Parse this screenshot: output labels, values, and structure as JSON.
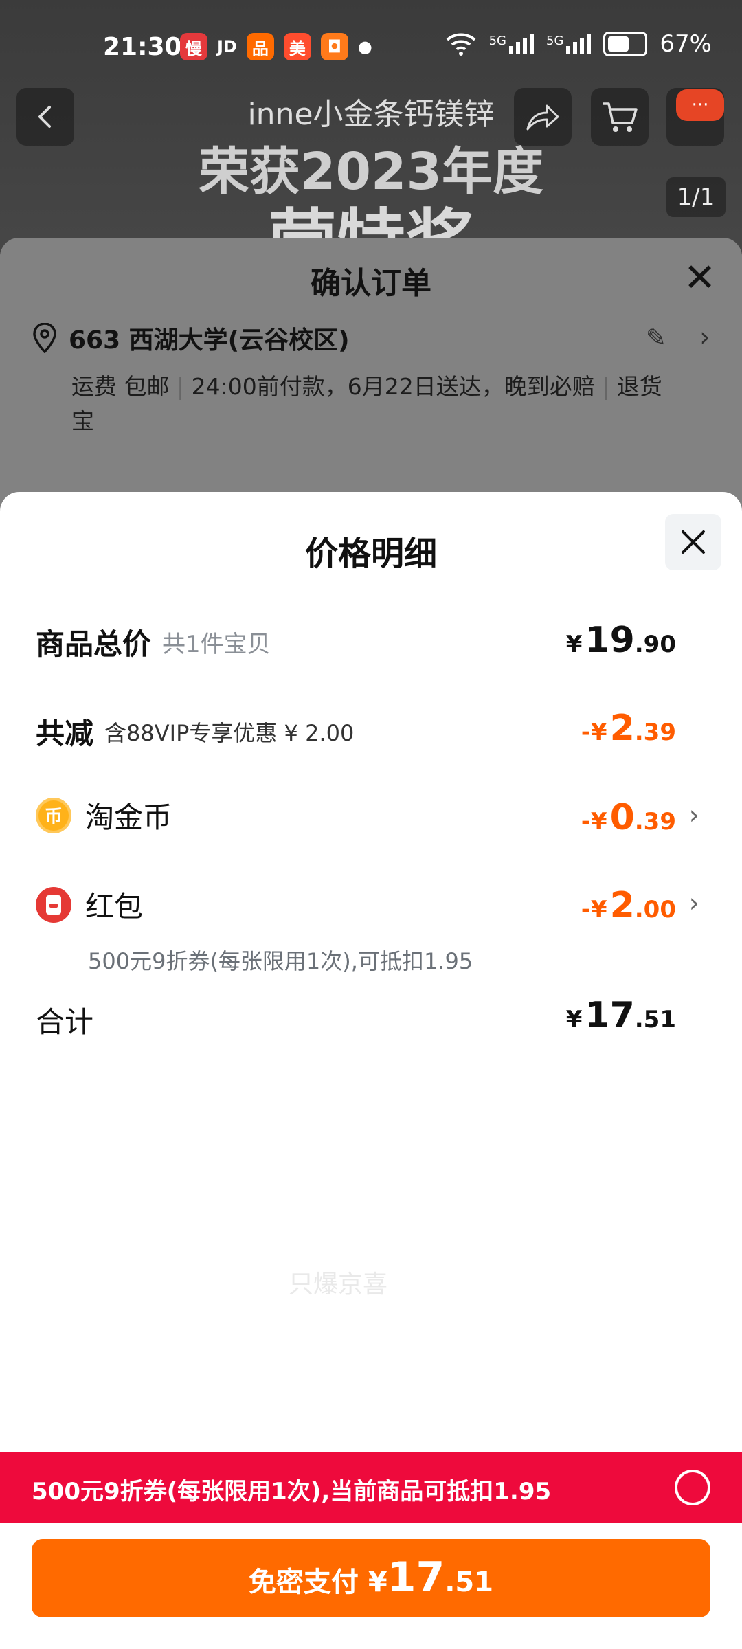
{
  "status_bar": {
    "time": "21:30",
    "battery": "67%",
    "signal1": "5G",
    "signal2": "5G",
    "jd": "JD"
  },
  "product_page": {
    "title": "inne小金条钙镁锌",
    "banner_line1": "荣获2023年度",
    "banner_line2": "营特奖",
    "image_counter": "1/1"
  },
  "confirm_order": {
    "title": "确认订单",
    "address": "663 西湖大学(云谷校区)",
    "shipping": "运费 包邮",
    "delivery": "24:00前付款，6月22日送达，晚到必赔",
    "return": "退货宝"
  },
  "price_detail": {
    "title": "价格明细",
    "goods_total": {
      "label": "商品总价",
      "sub": "共1件宝贝",
      "currency": "¥",
      "int": "19",
      "dec": ".90"
    },
    "total_discount": {
      "label": "共减",
      "sub": "含88VIP专享优惠 ¥ 2.00",
      "currency": "-¥",
      "int": "2",
      "dec": ".39"
    },
    "taojinbi": {
      "label": "淘金币",
      "currency": "-¥",
      "int": "0",
      "dec": ".39"
    },
    "hongbao": {
      "label": "红包",
      "currency": "-¥",
      "int": "2",
      "dec": ".00",
      "sub": "500元9折券(每张限用1次),可抵扣1.95"
    },
    "total": {
      "label": "合计",
      "currency": "¥",
      "int": "17",
      "dec": ".51"
    },
    "watermark": "只爆京喜"
  },
  "coupon_bar": {
    "text": "500元9折券(每张限用1次),当前商品可抵扣1.95"
  },
  "pay_button": {
    "label": "免密支付",
    "currency": "¥",
    "int": "17",
    "dec": ".51"
  },
  "colors": {
    "accent_orange": "#ff6a00",
    "discount_orange": "#ff5c00",
    "coupon_red": "#ee0a3c"
  }
}
